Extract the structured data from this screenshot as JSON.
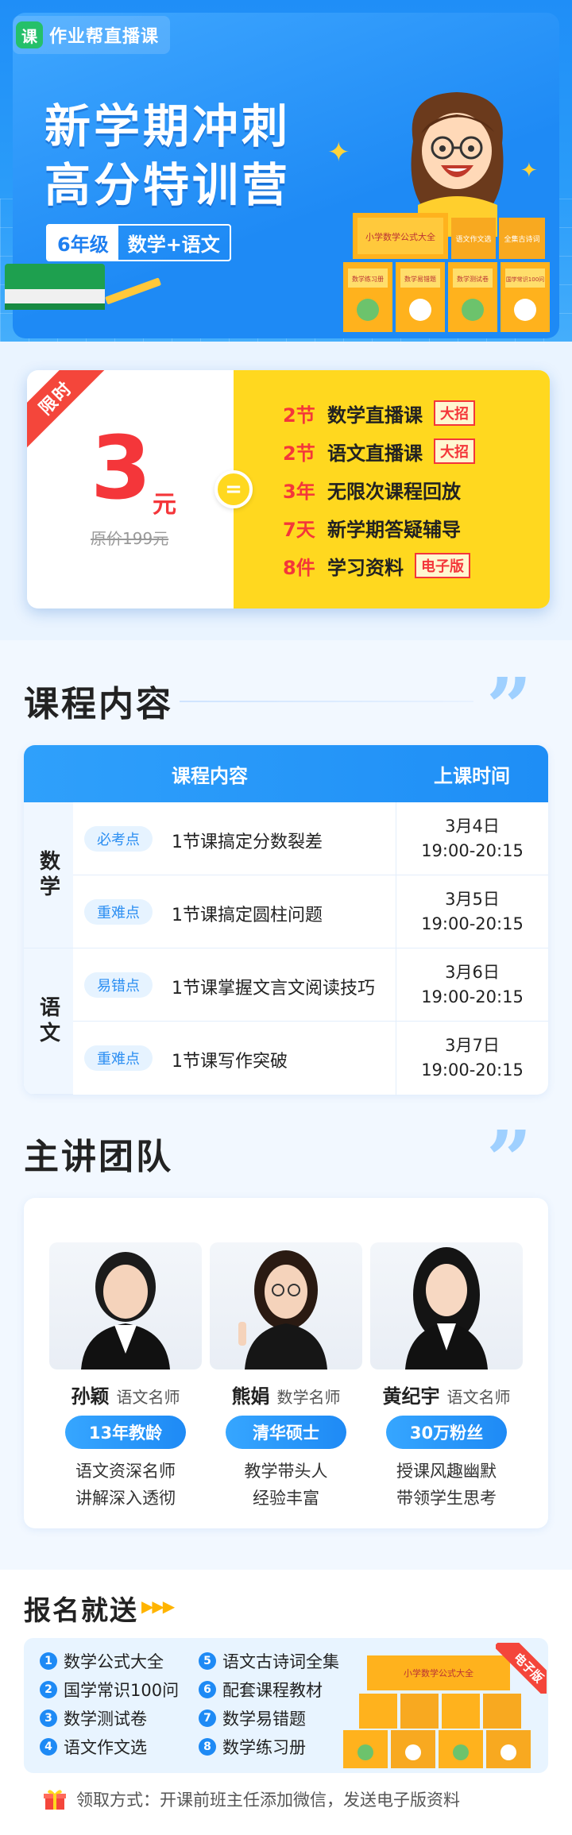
{
  "app": {
    "logo_mark": "课",
    "logo_text": "作业帮直播课"
  },
  "hero": {
    "title_line1": "新学期冲刺",
    "title_line2": "高分特训营",
    "grade": "6年级",
    "subjects": "数学+语文",
    "book_cover_title": "小学数学公式大全",
    "book_labels": [
      "数学练习册",
      "数学易错题",
      "数学测试卷",
      "国学常识100问"
    ],
    "book_top_labels": [
      "语文作文选",
      "全集古诗词"
    ]
  },
  "offer": {
    "ribbon": "限时",
    "price": "3",
    "price_unit": "元",
    "original_price": "原价199元",
    "equals": "=",
    "benefits": [
      {
        "num": "2节",
        "text": "数学直播课",
        "tag": "大招"
      },
      {
        "num": "2节",
        "text": "语文直播课",
        "tag": "大招"
      },
      {
        "num": "3年",
        "text": "无限次课程回放",
        "tag": ""
      },
      {
        "num": "7天",
        "text": "新学期答疑辅导",
        "tag": ""
      },
      {
        "num": "8件",
        "text": "学习资料",
        "tag": "电子版"
      }
    ]
  },
  "course": {
    "section_title": "课程内容",
    "quote": "”",
    "header_content": "课程内容",
    "header_time": "上课时间",
    "subjects": [
      "数学",
      "语文"
    ],
    "rows": [
      {
        "tag": "必考点",
        "title": "1节课搞定分数裂差",
        "date": "3月4日",
        "time": "19:00-20:15"
      },
      {
        "tag": "重难点",
        "title": "1节课搞定圆柱问题",
        "date": "3月5日",
        "time": "19:00-20:15"
      },
      {
        "tag": "易错点",
        "title": "1节课掌握文言文阅读技巧",
        "date": "3月6日",
        "time": "19:00-20:15"
      },
      {
        "tag": "重难点",
        "title": "1节课写作突破",
        "date": "3月7日",
        "time": "19:00-20:15"
      }
    ]
  },
  "team": {
    "section_title": "主讲团队",
    "quote": "”",
    "teachers": [
      {
        "name": "孙颖",
        "role": "语文名师",
        "badge": "13年教龄",
        "desc1": "语文资深名师",
        "desc2": "讲解深入透彻"
      },
      {
        "name": "熊娟",
        "role": "数学名师",
        "badge": "清华硕士",
        "desc1": "教学带头人",
        "desc2": "经验丰富"
      },
      {
        "name": "黄纪宇",
        "role": "语文名师",
        "badge": "30万粉丝",
        "desc1": "授课风趣幽默",
        "desc2": "带领学生思考"
      }
    ]
  },
  "gift": {
    "title": "报名就送",
    "arrows": "▶▶▶",
    "items": [
      {
        "num": "1",
        "label": "数学公式大全"
      },
      {
        "num": "5",
        "label": "语文古诗词全集"
      },
      {
        "num": "2",
        "label": "国学常识100问"
      },
      {
        "num": "6",
        "label": "配套课程教材"
      },
      {
        "num": "3",
        "label": "数学测试卷"
      },
      {
        "num": "7",
        "label": "数学易错题"
      },
      {
        "num": "4",
        "label": "语文作文选"
      },
      {
        "num": "8",
        "label": "数学练习册"
      }
    ],
    "ribbon": "电子版",
    "claim_text": "领取方式：开课前班主任添加微信，发送电子版资料"
  },
  "colors": {
    "brand_blue": "#1e8af5",
    "accent_red": "#f4363a",
    "accent_yellow": "#ffd81f",
    "brand_green": "#25c06a"
  },
  "icons": {
    "logo": "app-logo-icon",
    "gift": "gift-icon",
    "sparkle": "sparkle-icon",
    "quote": "quote-icon"
  }
}
